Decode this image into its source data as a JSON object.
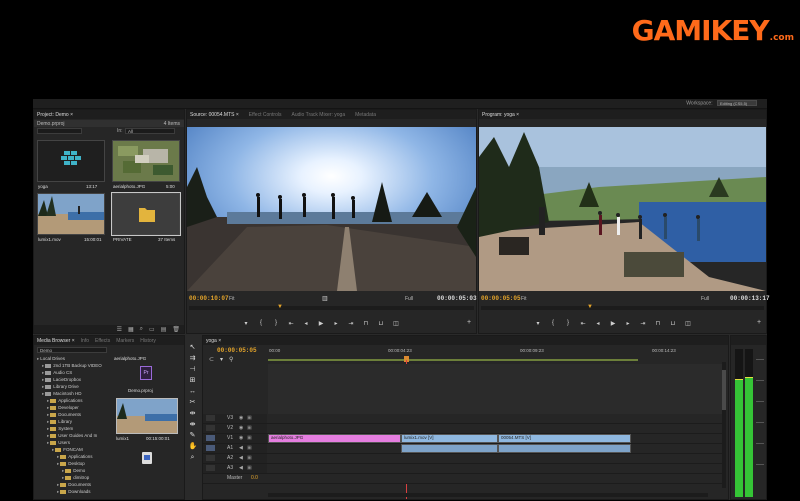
{
  "brand": {
    "logo_main": "GAMIKEY",
    "logo_domain": ".com"
  },
  "topbar": {
    "workspace_label": "Workspace:",
    "workspace_value": "Editing (CS5.5)"
  },
  "project": {
    "tab": "Project: Demo ×",
    "file": "Demo.prproj",
    "count": "4 Items",
    "search_label": "In:",
    "search_value": "All",
    "items": [
      {
        "name": "yoga",
        "meta": "13:17"
      },
      {
        "name": "aerialphoto.JPG",
        "meta": "5:00"
      },
      {
        "name": "lumix1.mov",
        "meta": "15:00:01"
      },
      {
        "name": "PRIVATE",
        "meta": "37 Items"
      }
    ]
  },
  "source": {
    "tabs": [
      "Source: 00054.MTS ×",
      "Effect Controls",
      "Audio Track Mixer: yoga",
      "Metadata"
    ],
    "timecode_left": "00:00:10:07",
    "fit": "Fit",
    "quality": "Full",
    "timecode_right": "00:00:05:03"
  },
  "program": {
    "tab": "Program: yoga ×",
    "timecode_left": "00:00:05:05",
    "fit": "Fit",
    "quality": "Full",
    "timecode_right": "00:00:13:17"
  },
  "media_browser": {
    "tabs": [
      "Media Browser ×",
      "Info",
      "Effects",
      "Markers",
      "History"
    ],
    "location": "Demo",
    "tree": [
      {
        "label": "Local Drives",
        "indent": 0
      },
      {
        "label": "2nd 1TB Backup VIDEO",
        "indent": 1
      },
      {
        "label": "Audio CS",
        "indent": 1
      },
      {
        "label": "LacieDropbox",
        "indent": 1
      },
      {
        "label": "Library Drive",
        "indent": 1
      },
      {
        "label": "Macintosh HD",
        "indent": 1
      },
      {
        "label": "Applications",
        "indent": 2
      },
      {
        "label": "Developer",
        "indent": 2
      },
      {
        "label": "Documents",
        "indent": 2
      },
      {
        "label": "Library",
        "indent": 2
      },
      {
        "label": "System",
        "indent": 2
      },
      {
        "label": "User Guides And In",
        "indent": 2
      },
      {
        "label": "Users",
        "indent": 2
      },
      {
        "label": "FONCAM",
        "indent": 3
      },
      {
        "label": "Applications",
        "indent": 4
      },
      {
        "label": "Desktop",
        "indent": 4
      },
      {
        "label": "Demo",
        "indent": 5
      },
      {
        "label": "dimitrop",
        "indent": 5
      },
      {
        "label": "Documents",
        "indent": 4
      },
      {
        "label": "Downloads",
        "indent": 4
      }
    ],
    "files": [
      {
        "name": "aerialphoto.JPG",
        "meta": ""
      },
      {
        "name": "Demo.prproj",
        "meta": ""
      },
      {
        "name": "lumix1",
        "meta": "00:15:00:01"
      }
    ]
  },
  "timeline": {
    "tab": "yoga ×",
    "timecode": "00:00:05:05",
    "ruler": [
      "00:00",
      "00:00:04:23",
      "00:00:09:23",
      "00:00:14:23"
    ],
    "tracks": [
      {
        "name": "V3"
      },
      {
        "name": "V2"
      },
      {
        "name": "V1"
      },
      {
        "name": "A1"
      },
      {
        "name": "A2"
      },
      {
        "name": "A3"
      }
    ],
    "master_label": "Master",
    "master_value": "0.0",
    "clips": [
      {
        "name": "aerialphoto.JPG",
        "color": "#e57ee0"
      },
      {
        "name": "lumix1.mov [V]",
        "color": "#8fb8e0"
      },
      {
        "name": "00054.MTS [V]",
        "color": "#8fb8e0"
      }
    ]
  },
  "colors": {
    "accent_timecode": "#e5a52a",
    "playhead": "#d94040",
    "meter": "#35c436"
  }
}
